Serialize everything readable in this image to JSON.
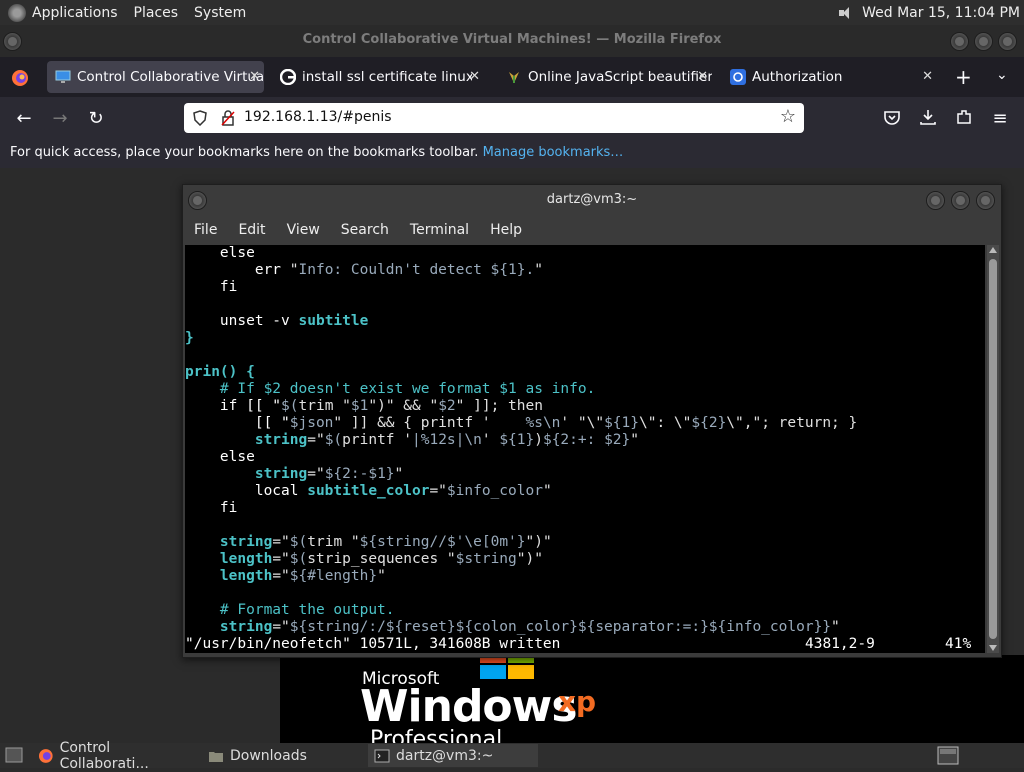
{
  "top_panel": {
    "menus": [
      "Applications",
      "Places",
      "System"
    ],
    "clock": "Wed Mar 15, 11:04 PM"
  },
  "window_title": "Control Collaborative Virtual Machines! — Mozilla Firefox",
  "tabs": [
    {
      "label": "Control Collaborative Virtua",
      "icon": "monitor-icon"
    },
    {
      "label": "install ssl certificate linux - G",
      "icon": "google-icon"
    },
    {
      "label": "Online JavaScript beautifier",
      "icon": "beautifier-icon"
    },
    {
      "label": "Authorization",
      "icon": "at-icon"
    }
  ],
  "url": "192.168.1.13/#penis",
  "bookmarks_bar": {
    "text": "For quick access, place your bookmarks here on the bookmarks toolbar.",
    "link": "Manage bookmarks…"
  },
  "vm_screen": {
    "brand_top": "Microsoft",
    "brand_main": "Windows",
    "brand_xp": "xp",
    "brand_edition": "Professional"
  },
  "terminal": {
    "title": "dartz@vm3:~",
    "menus": [
      "File",
      "Edit",
      "View",
      "Search",
      "Terminal",
      "Help"
    ],
    "status_file": "\"/usr/bin/neofetch\" 10571L, 341608B written",
    "status_pos": "4381,2-9",
    "status_pct": "41%"
  },
  "taskbar": {
    "items": [
      {
        "label": "Control Collaborati...",
        "icon": "firefox-icon"
      },
      {
        "label": "Downloads",
        "icon": "folder-icon"
      },
      {
        "label": "dartz@vm3:~",
        "icon": "terminal-icon"
      }
    ]
  },
  "colors": {
    "accent_link": "#54b3f0",
    "terminal_cyan": "#4cc2c7",
    "xp_orange": "#f26b22"
  }
}
